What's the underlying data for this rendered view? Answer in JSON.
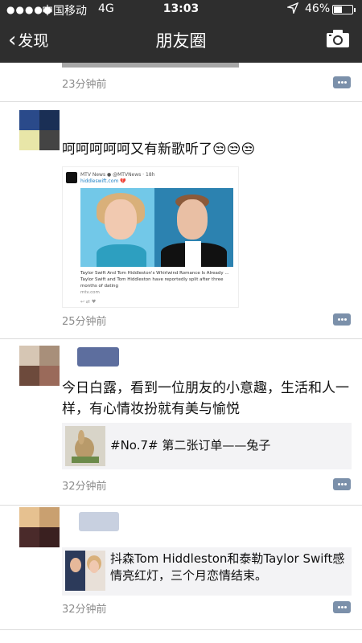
{
  "status_bar": {
    "signal": "●●●●●",
    "carrier": "中国移动",
    "network": "4G",
    "time": "13:03",
    "location_icon": "location-arrow-icon",
    "battery_percent": "46%",
    "battery_level": 0.46
  },
  "nav": {
    "back_label": "发现",
    "title": "朋友圈",
    "camera_icon": "camera-icon"
  },
  "posts": [
    {
      "time": "23分钟前"
    },
    {
      "text": "呵呵呵呵呵又有新歌听了😒😒😒",
      "time": "25分钟前",
      "tweet": {
        "header": "MTV News ● @MTVNews · 18h",
        "header_sub": "hiddleswift.com 💔",
        "caption": "Taylor Swift And Tom Hiddleston's Whirlwind Romance Is Already ... Taylor Swift and Tom Hiddleston have reportedly split after three months of dating",
        "source": "mtv.com",
        "actions": "↩ ⇄ ♥"
      }
    },
    {
      "text": "今日白露，看到一位朋友的小意趣，生活和人一样，有心情妆扮就有美与愉悦",
      "link_title": "#No.7# 第二张订单——兔子",
      "time": "32分钟前"
    },
    {
      "link_title": "抖森Tom Hiddleston和泰勒Taylor Swift感情亮红灯，三个月恋情结束。",
      "time": "32分钟前"
    }
  ],
  "colors": {
    "header_bg": "#2e2e2e",
    "timestamp": "#8c8c8c",
    "comment_icon": "#7b90aa",
    "link_card_bg": "#f3f3f5"
  }
}
